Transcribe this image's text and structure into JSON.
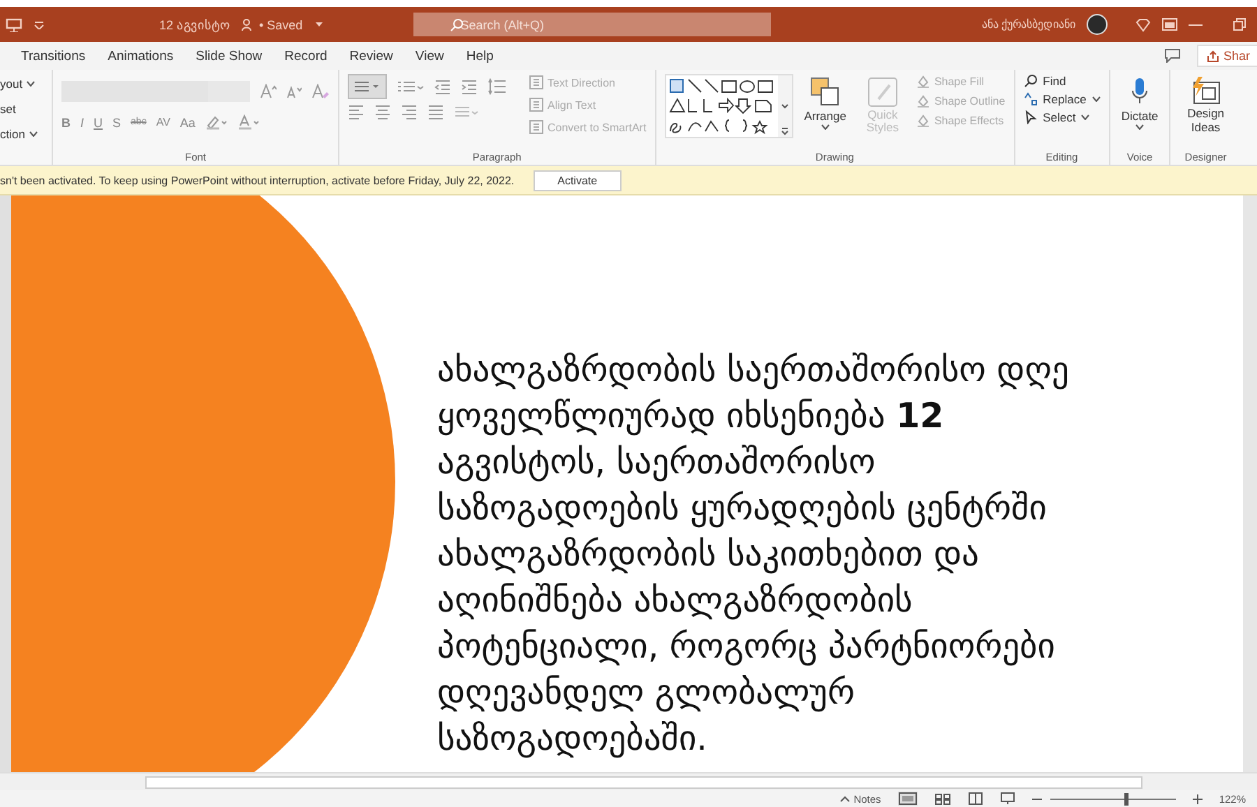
{
  "title_bar": {
    "document": "12 აგვისტო",
    "status": "• Saved",
    "search": {
      "placeholder": "Search (Alt+Q)"
    },
    "user": "ანა ქურასბედიანი"
  },
  "tabs": [
    {
      "label": "Transitions",
      "selected": false
    },
    {
      "label": "Animations",
      "selected": false
    },
    {
      "label": "Slide Show",
      "selected": false
    },
    {
      "label": "Record",
      "selected": false
    },
    {
      "label": "Review",
      "selected": false
    },
    {
      "label": "View",
      "selected": false
    },
    {
      "label": "Help",
      "selected": false
    }
  ],
  "share": "Shar",
  "ribbon": {
    "clipped_commands": [
      {
        "label": "yout",
        "dropdown": true
      },
      {
        "label": "set",
        "dropdown": false
      },
      {
        "label": "ction",
        "dropdown": true
      }
    ],
    "font": {
      "label": "Font",
      "format_buttons": [
        "B",
        "I",
        "U",
        "S",
        "abc",
        "AV",
        "Aa"
      ]
    },
    "paragraph": {
      "label": "Paragraph",
      "commands": [
        {
          "label": "Text Direction",
          "disabled": true
        },
        {
          "label": "Align Text",
          "disabled": true
        },
        {
          "label": "Convert to SmartArt",
          "disabled": true
        }
      ]
    },
    "drawing": {
      "label": "Drawing",
      "arrange": "Arrange",
      "quick_styles": {
        "label": "Quick Styles",
        "disabled": true
      },
      "commands": [
        {
          "label": "Shape Fill",
          "disabled": true
        },
        {
          "label": "Shape Outline",
          "disabled": true
        },
        {
          "label": "Shape Effects",
          "disabled": true
        }
      ]
    },
    "editing": {
      "label": "Editing",
      "commands": [
        {
          "label": "Find",
          "dropdown": false
        },
        {
          "label": "Replace",
          "dropdown": true
        },
        {
          "label": "Select",
          "dropdown": true
        }
      ]
    },
    "voice": {
      "label": "Voice",
      "button": "Dictate"
    },
    "designer": {
      "label": "Designer",
      "button": "Design Ideas"
    }
  },
  "notification": {
    "message": "sn't been activated. To keep using PowerPoint without interruption, activate before Friday, July 22, 2022.",
    "button": "Activate"
  },
  "slide": {
    "paragraph": "ახალგაზრდობის საერთაშორისო დღე\nყოველწლიურად იხსენიება **12**\nაგვისტოს, საერთაშორისო\nსაზოგადოების ყურადღების ცენტრში\nახალგაზრდობის საკითხებით და\nაღინიშნება ახალგაზრდობის\nპოტენციალი, როგორც პარტნიორები\nდღევანდელ გლობალურ\nსაზოგადოებაში."
  },
  "status_bar": {
    "notes": "Notes",
    "zoom": {
      "level": 0.6,
      "reading": "122%"
    }
  }
}
